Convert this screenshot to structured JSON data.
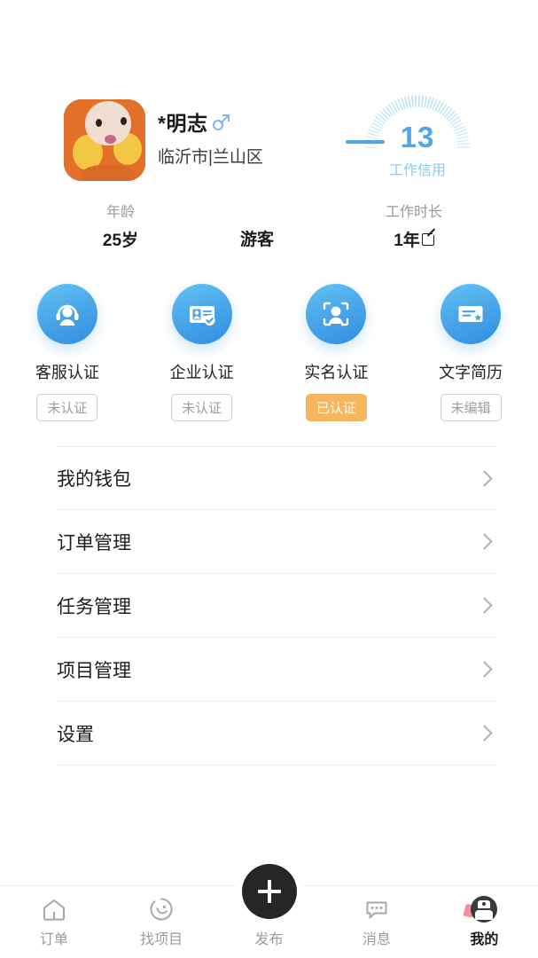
{
  "profile": {
    "avatar_icon": "cartoon-cat-avatar",
    "name": "*明志",
    "gender_icon": "male-symbol-icon",
    "location": "临沂市|兰山区"
  },
  "credit_gauge": {
    "score": "13",
    "label": "工作信用",
    "accent_color": "#4ea6ec",
    "label_color": "#8ecaf2"
  },
  "stats": [
    {
      "label": "年龄",
      "value": "25岁"
    },
    {
      "label": "",
      "value": "游客"
    },
    {
      "label": "工作时长",
      "value": "1年",
      "edit_icon": "edit-square-icon"
    }
  ],
  "certifications": [
    {
      "icon": "headset-support-icon",
      "label": "客服认证",
      "badge": "未认证",
      "verified": false
    },
    {
      "icon": "id-card-check-icon",
      "label": "企业认证",
      "badge": "未认证",
      "verified": false
    },
    {
      "icon": "face-scan-icon",
      "label": "实名认证",
      "badge": "已认证",
      "verified": true
    },
    {
      "icon": "certificate-star-icon",
      "label": "文字简历",
      "badge": "未编辑",
      "verified": false
    }
  ],
  "badge_colors": {
    "verified_bg": "#f6b55f",
    "unverified_text": "#9e9e9e"
  },
  "menu": [
    {
      "label": "我的钱包",
      "chevron": "chevron-right-icon"
    },
    {
      "label": "订单管理",
      "chevron": "chevron-right-icon"
    },
    {
      "label": "任务管理",
      "chevron": "chevron-right-icon"
    },
    {
      "label": "项目管理",
      "chevron": "chevron-right-icon"
    },
    {
      "label": "设置",
      "chevron": "chevron-right-icon"
    }
  ],
  "tabbar": {
    "items": [
      {
        "label": "订单",
        "icon": "home-icon",
        "active": false
      },
      {
        "label": "找项目",
        "icon": "circle-smiley-icon",
        "active": false
      },
      {
        "label": "发布",
        "icon": "plus-icon",
        "active": false
      },
      {
        "label": "消息",
        "icon": "chat-bubble-icon",
        "active": false
      },
      {
        "label": "我的",
        "icon": "user-avatar-icon",
        "active": true
      }
    ],
    "publish_button_icon": "plus-icon"
  }
}
